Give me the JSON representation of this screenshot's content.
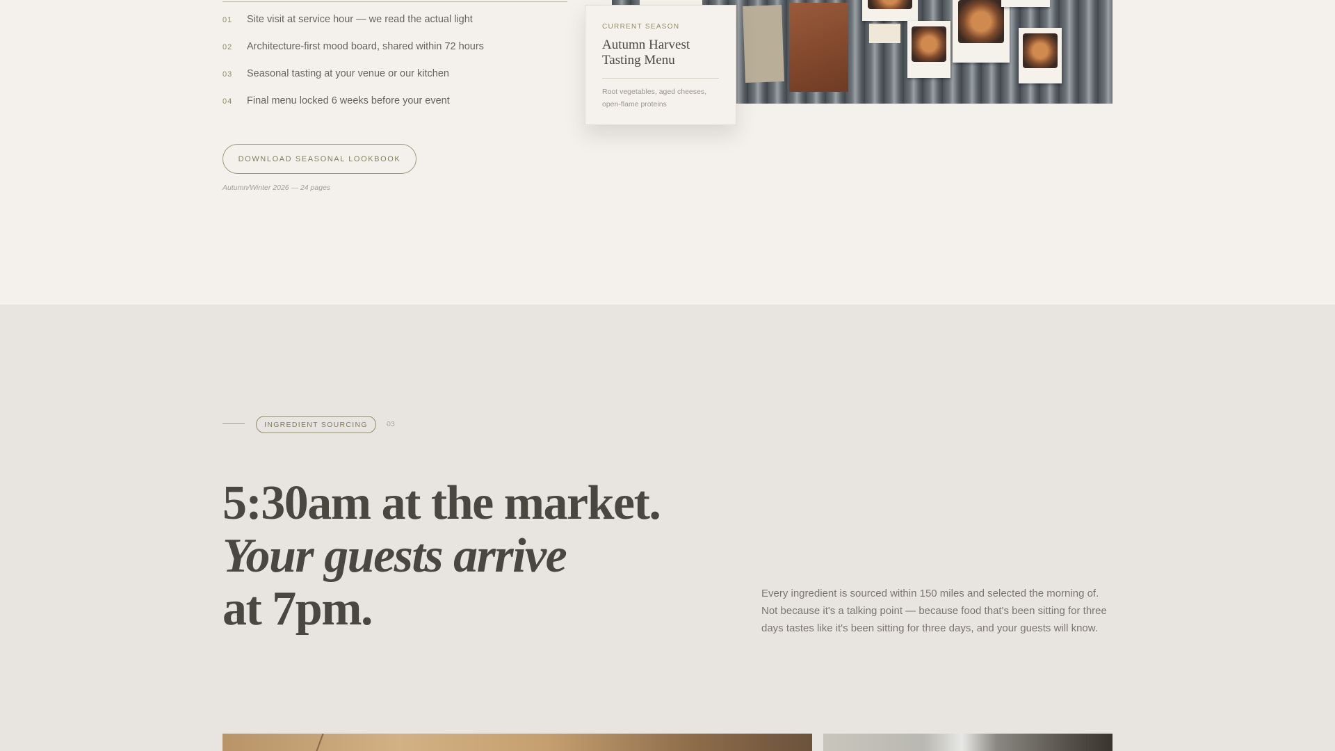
{
  "process": {
    "steps": [
      {
        "num": "01",
        "text": "Site visit at service hour — we read the actual light"
      },
      {
        "num": "02",
        "text": "Architecture-first mood board, shared within 72 hours"
      },
      {
        "num": "03",
        "text": "Seasonal tasting at your venue or our kitchen"
      },
      {
        "num": "04",
        "text": "Final menu locked 6 weeks before your event"
      }
    ],
    "download_label": "DOWNLOAD SEASONAL LOOKBOOK",
    "download_meta": "Autumn/Winter 2026 — 24 pages"
  },
  "season_card": {
    "eyebrow": "CURRENT SEASON",
    "title": "Autumn Harvest Tasting Menu",
    "description": "Root vegetables, aged cheeses, open-flame proteins"
  },
  "sourcing": {
    "eyebrow": "INGREDIENT SOURCING",
    "eyebrow_num": "03",
    "headline_line1": "5:30am at the market.",
    "headline_line2": "Your guests arrive",
    "headline_line3": "at 7pm.",
    "body": "Every ingredient is sourced within 150 miles and selected the morning of. Not because it's a talking point — because food that's been sitting for three days tastes like it's been sitting for three days, and your guests will know."
  },
  "colors": {
    "background": "#f4f1ec",
    "section_background": "#e8e4df",
    "accent_olive": "#8a8b62",
    "text_dark": "#4a4640"
  }
}
